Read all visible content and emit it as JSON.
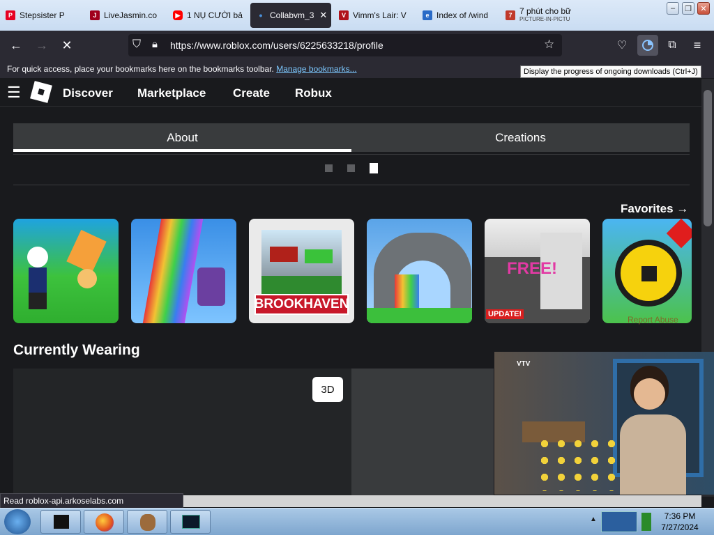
{
  "browser": {
    "tabs": [
      {
        "title": "Stepsister P",
        "icon": "pinterest-icon",
        "color": "#e60023"
      },
      {
        "title": "LiveJasmin.co",
        "icon": "livejasmin-icon",
        "color": "#a0001c"
      },
      {
        "title": "1 NỤ CƯỜI bả",
        "icon": "youtube-icon",
        "color": "#ff0000"
      },
      {
        "title": "Collabvm_3",
        "icon": "dot-icon",
        "color": "#4a90d9",
        "active": true
      },
      {
        "title": "Vimm's Lair: V",
        "icon": "vimm-icon",
        "color": "#b0121b"
      },
      {
        "title": "Index of /wind",
        "icon": "ie-doc-icon",
        "color": "#2a6bc7"
      },
      {
        "title": "7 phút cho bữ",
        "subtitle": "PICTURE-IN-PICTU",
        "icon": "vtv-icon",
        "color": "#c0392b"
      }
    ],
    "url": "https://www.roblox.com/users/6225633218/profile",
    "bookmarks_text": "For quick access, place your bookmarks here on the bookmarks toolbar.",
    "bookmarks_link": "Manage bookmarks...",
    "tooltip": "Display the progress of ongoing downloads (Ctrl+J)",
    "status": "Read roblox-api.arkoselabs.com"
  },
  "roblox": {
    "nav": [
      "Discover",
      "Marketplace",
      "Create",
      "Robux"
    ],
    "tabs": [
      "About",
      "Creations"
    ],
    "favorites": "Favorites →",
    "report": "Report Abuse",
    "currently_wearing": "Currently Wearing",
    "btn_3d": "3D",
    "game_cards": [
      {
        "name": "game-noob-characters",
        "label": ""
      },
      {
        "name": "game-rainbow-stairs",
        "label": ""
      },
      {
        "name": "game-brookhaven",
        "label": "BROOKHAVEN"
      },
      {
        "name": "game-stone-arch",
        "label": ""
      },
      {
        "name": "game-free-update",
        "label": "FREE!",
        "badge": "UPDATE!"
      },
      {
        "name": "game-robux-coin",
        "label": ""
      }
    ]
  },
  "taskbar": {
    "time": "7:36 PM",
    "date": "7/27/2024"
  },
  "colors": {
    "bg": "#191a1d",
    "panel": "#393b3d",
    "accent_link": "#7cc8ff"
  }
}
